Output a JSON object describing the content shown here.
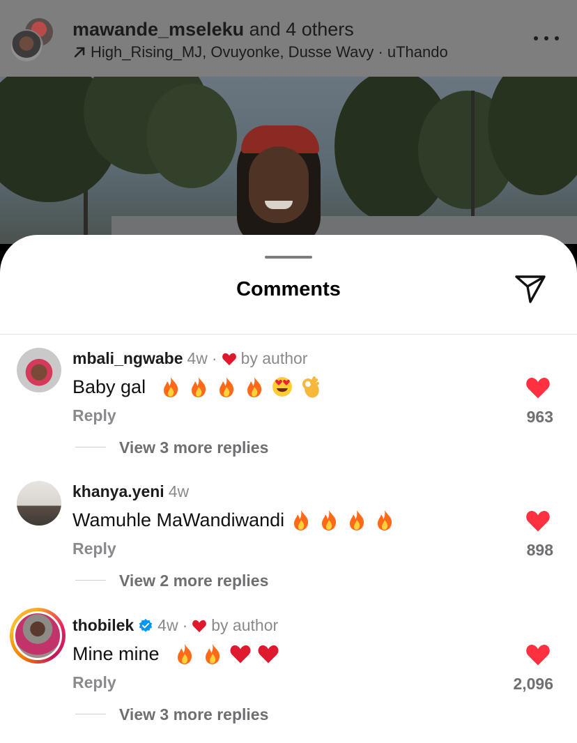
{
  "header": {
    "username": "mawande_mseleku",
    "and_others": " and 4 others",
    "collaborators": "High_Rising_MJ, Ovuyonke, Dusse Wavy · uThando"
  },
  "sheet": {
    "title": "Comments"
  },
  "comments": [
    {
      "username": "mbali_ngwabe",
      "time": "4w",
      "dot": "·",
      "liked_by_author": true,
      "by_author": "by author",
      "text": "Baby gal",
      "emojis": [
        "fire-emoji",
        "fire-emoji",
        "fire-emoji",
        "fire-emoji",
        "heart-eyes-emoji",
        "ok-hand-emoji"
      ],
      "reply": "Reply",
      "likes": "963",
      "view_replies": "View 3 more replies"
    },
    {
      "username": "khanya.yeni",
      "time": "4w",
      "liked_by_author": false,
      "text": "Wamuhle MaWandiwandi",
      "emojis": [
        "fire-emoji",
        "fire-emoji",
        "fire-emoji",
        "fire-emoji"
      ],
      "reply": "Reply",
      "likes": "898",
      "view_replies": "View 2 more replies"
    },
    {
      "username": "thobilek",
      "verified": true,
      "time": "4w",
      "dot": "·",
      "liked_by_author": true,
      "by_author": "by author",
      "text": "Mine mine",
      "emojis": [
        "fire-emoji",
        "fire-emoji",
        "red-heart-emoji",
        "red-heart-emoji"
      ],
      "reply": "Reply",
      "likes": "2,096",
      "view_replies": "View 3 more replies"
    }
  ],
  "colors": {
    "like_red": "#ff3040",
    "verified_blue": "#0095f6",
    "muted_text": "#8a8a8e",
    "sheet_bg": "#ffffff",
    "dim_overlay": "#7e7e7e"
  }
}
